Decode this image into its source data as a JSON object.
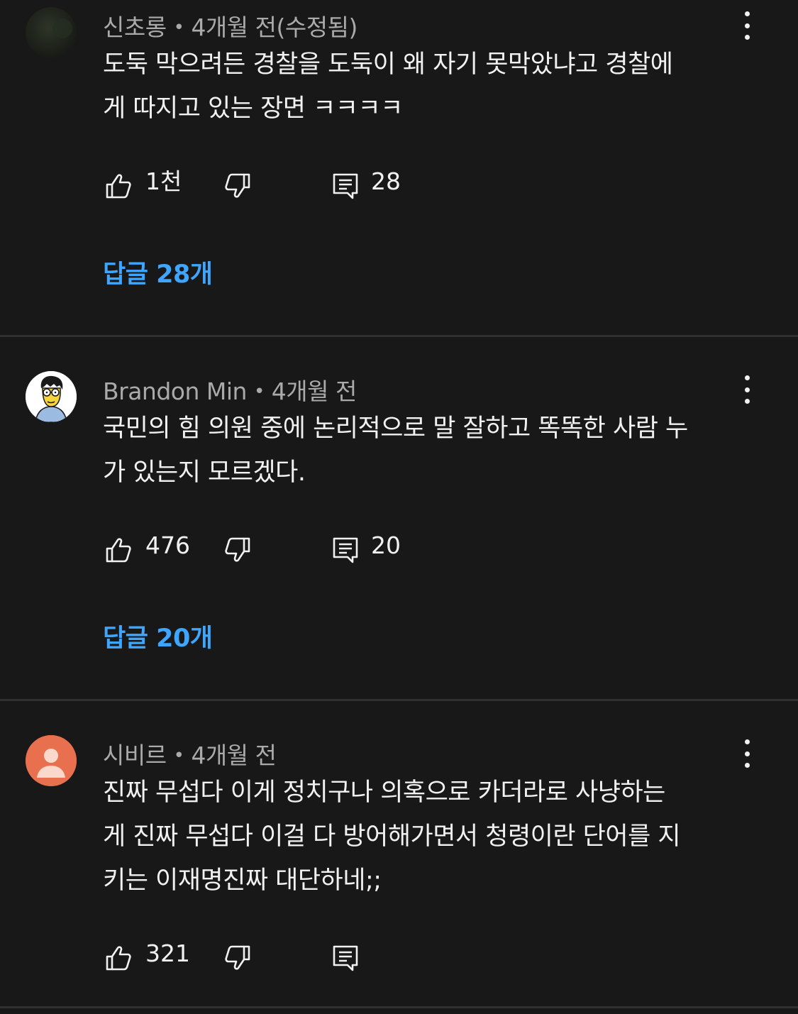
{
  "comments": [
    {
      "author": "신초롱",
      "time": "4개월 전(수정됨)",
      "text_lines": [
        "도둑 막으려든 경찰을 도둑이 왜 자기 못막았냐고 경찰에",
        "게 따지고 있는 장면 ㅋㅋㅋㅋ"
      ],
      "likes": "1천",
      "reply_count": "28",
      "replies_label": "답글 28개",
      "avatar_icon": "dark-photo-avatar"
    },
    {
      "author": "Brandon Min",
      "time": "4개월 전",
      "text_lines": [
        "국민의 힘 의원 중에 논리적으로 말 잘하고 똑똑한 사람 누",
        "가 있는지 모르겠다."
      ],
      "likes": "476",
      "reply_count": "20",
      "replies_label": "답글 20개",
      "avatar_icon": "cartoon-avatar"
    },
    {
      "author": "시비르",
      "time": "4개월 전",
      "text_lines": [
        "진짜 무섭다 이게 정치구나 의혹으로 카더라로 사냥하는",
        "게 진짜 무섭다 이걸 다 방어해가면서 청령이란 단어를 지",
        "키는 이재명진짜 대단하네;;"
      ],
      "likes": "321",
      "reply_count": "",
      "avatar_icon": "default-person-avatar"
    }
  ],
  "colors": {
    "background": "#181818",
    "text": "#f1f1f1",
    "meta": "#aaaaaa",
    "link": "#3ea6ff",
    "divider": "#303030",
    "default_avatar": "#e8704f"
  },
  "icons": {
    "more": "more-vert-icon",
    "like": "thumb-up-icon",
    "dislike": "thumb-down-icon",
    "reply": "comment-icon"
  }
}
